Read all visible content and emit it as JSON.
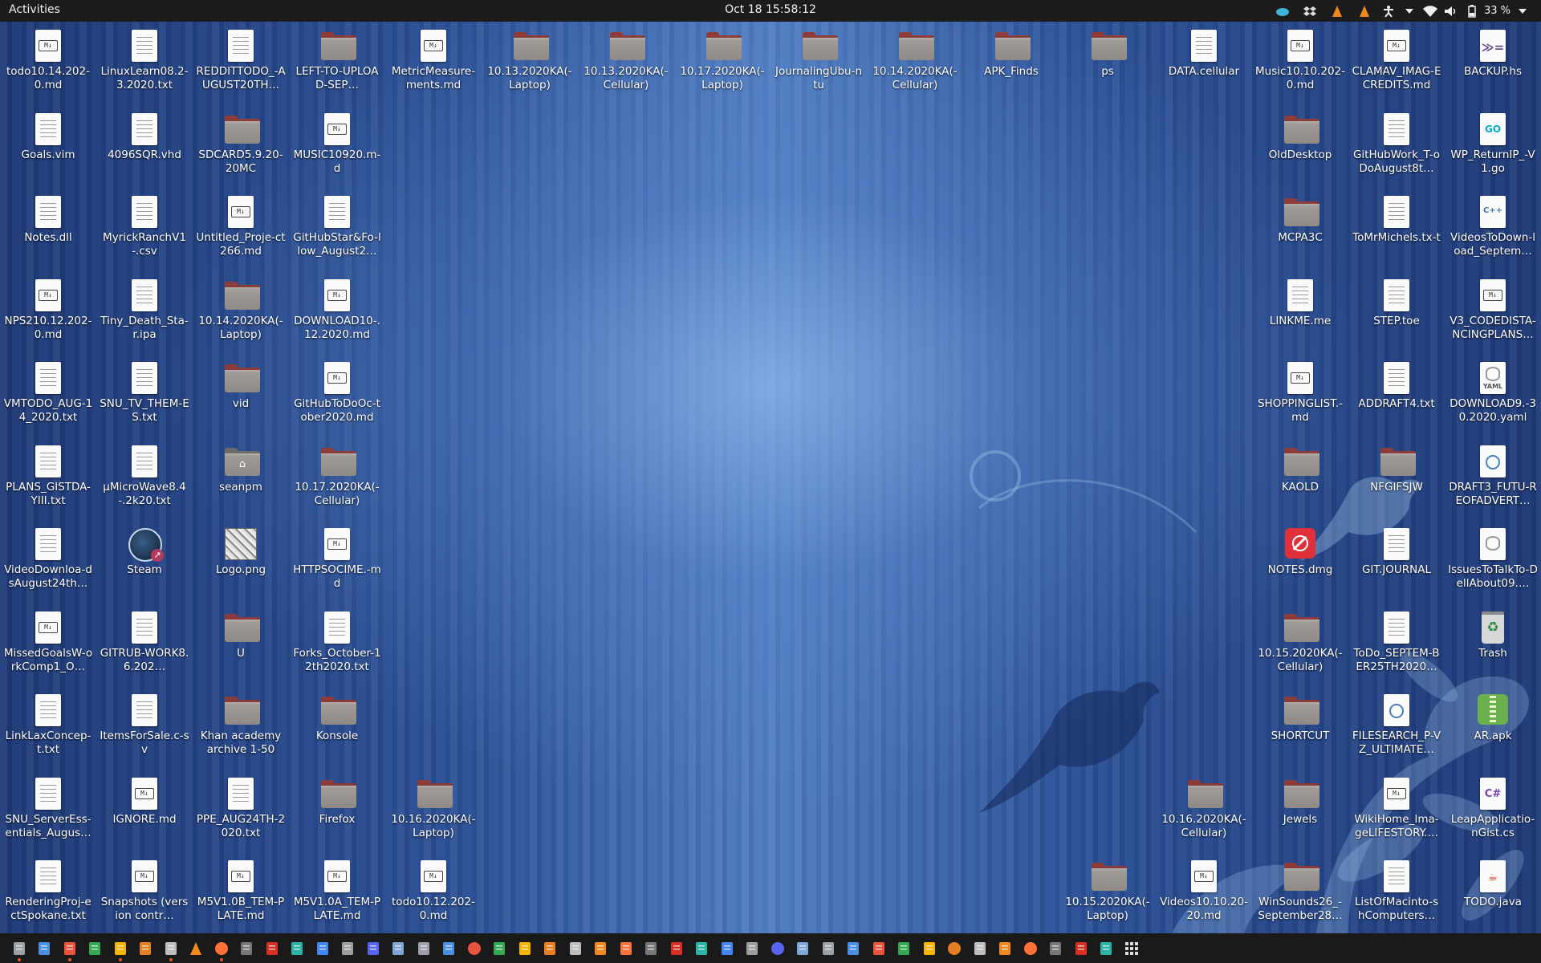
{
  "topbar": {
    "activities": "Activities",
    "clock": "Oct 18  15:58:12",
    "battery": "33 %",
    "tray_icons": [
      "cloud-icon",
      "dropbox-icon",
      "vlc-icon",
      "vlc-icon",
      "accessibility-icon",
      "chevron-down-icon",
      "wifi-icon",
      "volume-icon",
      "battery-icon",
      "chevron-down-icon"
    ]
  },
  "icons": [
    {
      "label": "todo10.14.202-0.md",
      "type": "md",
      "col": 0,
      "row": 0
    },
    {
      "label": "LinuxLearn08.2-3.2020.txt",
      "type": "txt",
      "col": 1,
      "row": 0
    },
    {
      "label": "REDDITTODO_-AUGUST20TH…",
      "type": "txt",
      "col": 2,
      "row": 0
    },
    {
      "label": "LEFT-TO-UPLOAD-SEP…",
      "type": "folder",
      "col": 3,
      "row": 0
    },
    {
      "label": "MetricMeasure-ments.md",
      "type": "md",
      "col": 4,
      "row": 0
    },
    {
      "label": "10.13.2020KA(-Laptop)",
      "type": "folder",
      "col": 5,
      "row": 0
    },
    {
      "label": "10.13.2020KA(-Cellular)",
      "type": "folder",
      "col": 6,
      "row": 0
    },
    {
      "label": "10.17.2020KA(-Laptop)",
      "type": "folder",
      "col": 7,
      "row": 0
    },
    {
      "label": "JournalingUbu-ntu",
      "type": "folder",
      "col": 8,
      "row": 0
    },
    {
      "label": "10.14.2020KA(-Cellular)",
      "type": "folder",
      "col": 9,
      "row": 0
    },
    {
      "label": "APK_Finds",
      "type": "folder",
      "col": 10,
      "row": 0
    },
    {
      "label": "ps",
      "type": "folder",
      "col": 11,
      "row": 0
    },
    {
      "label": "DATA.cellular",
      "type": "txt",
      "col": 12,
      "row": 0
    },
    {
      "label": "Music10.10.202-0.md",
      "type": "md",
      "col": 13,
      "row": 0
    },
    {
      "label": "CLAMAV_IMAG-ECREDITS.md",
      "type": "md",
      "col": 14,
      "row": 0
    },
    {
      "label": "BACKUP.hs",
      "type": "haskell",
      "col": 15,
      "row": 0
    },
    {
      "label": "Goals.vim",
      "type": "txt",
      "col": 0,
      "row": 1
    },
    {
      "label": "4096SQR.vhd",
      "type": "txt",
      "col": 1,
      "row": 1
    },
    {
      "label": "SDCARD5.9.20-20MC",
      "type": "folder",
      "col": 2,
      "row": 1
    },
    {
      "label": "MUSIC10920.m-d",
      "type": "md",
      "col": 3,
      "row": 1
    },
    {
      "label": "OldDesktop",
      "type": "folder",
      "col": 13,
      "row": 1
    },
    {
      "label": "GitHubWork_T-oDoAugust8t…",
      "type": "txt",
      "col": 14,
      "row": 1
    },
    {
      "label": "WP_ReturnIP_-V1.go",
      "type": "go",
      "col": 15,
      "row": 1
    },
    {
      "label": "Notes.dll",
      "type": "txt",
      "col": 0,
      "row": 2
    },
    {
      "label": "MyrickRanchV1-.csv",
      "type": "txt",
      "col": 1,
      "row": 2
    },
    {
      "label": "Untitled_Proje-ct266.md",
      "type": "md",
      "col": 2,
      "row": 2
    },
    {
      "label": "GitHubStar&Fo-llow_August2…",
      "type": "txt",
      "col": 3,
      "row": 2
    },
    {
      "label": "MCPA3C",
      "type": "folder",
      "col": 13,
      "row": 2
    },
    {
      "label": "ToMrMichels.tx-t",
      "type": "txt",
      "col": 14,
      "row": 2
    },
    {
      "label": "VideosToDown-load_Septem…",
      "type": "cpp",
      "col": 15,
      "row": 2
    },
    {
      "label": "NPS210.12.202-0.md",
      "type": "md",
      "col": 0,
      "row": 3
    },
    {
      "label": "Tiny_Death_Sta-r.ipa",
      "type": "txt",
      "col": 1,
      "row": 3
    },
    {
      "label": "10.14.2020KA(-Laptop)",
      "type": "folder",
      "col": 2,
      "row": 3
    },
    {
      "label": "DOWNLOAD10-.12.2020.md",
      "type": "md",
      "col": 3,
      "row": 3
    },
    {
      "label": "LINKME.me",
      "type": "txt",
      "col": 13,
      "row": 3
    },
    {
      "label": "STEP.toe",
      "type": "txt",
      "col": 14,
      "row": 3
    },
    {
      "label": "V3_CODEDISTA-NCINGPLANS…",
      "type": "md",
      "col": 15,
      "row": 3
    },
    {
      "label": "VMTODO_AUG-14_2020.txt",
      "type": "txt",
      "col": 0,
      "row": 4
    },
    {
      "label": "SNU_TV_THEM-ES.txt",
      "type": "txt",
      "col": 1,
      "row": 4
    },
    {
      "label": "vid",
      "type": "folder",
      "col": 2,
      "row": 4
    },
    {
      "label": "GitHubToDoOc-tober2020.md",
      "type": "md",
      "col": 3,
      "row": 4
    },
    {
      "label": "SHOPPINGLIST.-md",
      "type": "md",
      "col": 13,
      "row": 4
    },
    {
      "label": "ADDRAFT4.txt",
      "type": "txt",
      "col": 14,
      "row": 4
    },
    {
      "label": "DOWNLOAD9.-30.2020.yaml",
      "type": "yaml",
      "col": 15,
      "row": 4
    },
    {
      "label": "PLANS_GISTDA-YIII.txt",
      "type": "txt",
      "col": 0,
      "row": 5
    },
    {
      "label": "µMicroWave8.4-.2k20.txt",
      "type": "txt",
      "col": 1,
      "row": 5
    },
    {
      "label": "seanpm",
      "type": "home",
      "col": 2,
      "row": 5
    },
    {
      "label": "10.17.2020KA(-Cellular)",
      "type": "folder",
      "col": 3,
      "row": 5
    },
    {
      "label": "KAOLD",
      "type": "folder",
      "col": 13,
      "row": 5
    },
    {
      "label": "NFGIFSJW",
      "type": "folder",
      "col": 14,
      "row": 5
    },
    {
      "label": "DRAFT3_FUTU-REOFADVERT…",
      "type": "round",
      "col": 15,
      "row": 5
    },
    {
      "label": "VideoDownloa-dsAugust24th…",
      "type": "txt",
      "col": 0,
      "row": 6
    },
    {
      "label": "Steam",
      "type": "steam",
      "col": 1,
      "row": 6
    },
    {
      "label": "Logo.png",
      "type": "image",
      "col": 2,
      "row": 6
    },
    {
      "label": "HTTPSOCIME.-md",
      "type": "md",
      "col": 3,
      "row": 6
    },
    {
      "label": "NOTES.dmg",
      "type": "dmg",
      "col": 13,
      "row": 6
    },
    {
      "label": "GIT.JOURNAL",
      "type": "txt",
      "col": 14,
      "row": 6
    },
    {
      "label": "IssuesToTalkTo-DellAbout09.…",
      "type": "db",
      "col": 15,
      "row": 6
    },
    {
      "label": "MissedGoalsW-orkComp1_O…",
      "type": "md",
      "col": 0,
      "row": 7
    },
    {
      "label": "GITRUB-WORK8.6.202…",
      "type": "txt",
      "col": 1,
      "row": 7
    },
    {
      "label": "U",
      "type": "folder",
      "col": 2,
      "row": 7
    },
    {
      "label": "Forks_October-12th2020.txt",
      "type": "txt",
      "col": 3,
      "row": 7
    },
    {
      "label": "10.15.2020KA(-Cellular)",
      "type": "folder",
      "col": 13,
      "row": 7
    },
    {
      "label": "ToDo_SEPTEM-BER25TH2020…",
      "type": "txt",
      "col": 14,
      "row": 7
    },
    {
      "label": "Trash",
      "type": "trash",
      "col": 15,
      "row": 7
    },
    {
      "label": "LinkLaxConcep-t.txt",
      "type": "txt",
      "col": 0,
      "row": 8
    },
    {
      "label": "ItemsForSale.c-sv",
      "type": "txt",
      "col": 1,
      "row": 8
    },
    {
      "label": "Khan academy archive 1-50",
      "type": "folder",
      "col": 2,
      "row": 8
    },
    {
      "label": "Konsole",
      "type": "folder",
      "col": 3,
      "row": 8
    },
    {
      "label": "SHORTCUT",
      "type": "folder",
      "col": 13,
      "row": 8
    },
    {
      "label": "FILESEARCH_P-VZ_ULTIMATE…",
      "type": "round",
      "col": 14,
      "row": 8
    },
    {
      "label": "AR.apk",
      "type": "apk",
      "col": 15,
      "row": 8
    },
    {
      "label": "SNU_ServerEss-entials_Augus…",
      "type": "txt",
      "col": 0,
      "row": 9
    },
    {
      "label": "IGNORE.md",
      "type": "md",
      "col": 1,
      "row": 9
    },
    {
      "label": "PPE_AUG24TH-2020.txt",
      "type": "txt",
      "col": 2,
      "row": 9
    },
    {
      "label": "Firefox",
      "type": "folder",
      "col": 3,
      "row": 9
    },
    {
      "label": "10.16.2020KA(-Laptop)",
      "type": "folder",
      "col": 4,
      "row": 9
    },
    {
      "label": "10.16.2020KA(-Cellular)",
      "type": "folder",
      "col": 12,
      "row": 9
    },
    {
      "label": "Jewels",
      "type": "folder",
      "col": 13,
      "row": 9
    },
    {
      "label": "WikiHome_Ima-geLIFESTORY.…",
      "type": "md",
      "col": 14,
      "row": 9
    },
    {
      "label": "LeapApplicatio-nGist.cs",
      "type": "csharp",
      "col": 15,
      "row": 9
    },
    {
      "label": "RenderingProj-ectSpokane.txt",
      "type": "txt",
      "col": 0,
      "row": 10
    },
    {
      "label": "Snapshots (version contr…",
      "type": "md",
      "col": 1,
      "row": 10
    },
    {
      "label": "M5V1.0B_TEM-PLATE.md",
      "type": "md",
      "col": 2,
      "row": 10
    },
    {
      "label": "M5V1.0A_TEM-PLATE.md",
      "type": "md",
      "col": 3,
      "row": 10
    },
    {
      "label": "todo10.12.202-0.md",
      "type": "md",
      "col": 4,
      "row": 10
    },
    {
      "label": "10.15.2020KA(-Laptop)",
      "type": "folder",
      "col": 11,
      "row": 10
    },
    {
      "label": "Videos10.10.20-20.md",
      "type": "md",
      "col": 12,
      "row": 10
    },
    {
      "label": "WinSounds26_-September28…",
      "type": "folder",
      "col": 13,
      "row": 10
    },
    {
      "label": "ListOfMacinto-shComputers…",
      "type": "txt",
      "col": 14,
      "row": 10
    },
    {
      "label": "TODO.java",
      "type": "java",
      "col": 15,
      "row": 10
    }
  ],
  "colors": {
    "folder_tab": "#8d3b3b",
    "topbar": "#1c1c1c",
    "taskbar": "#1a1a1a",
    "desktop": "#2f4e8f"
  },
  "taskbar": [
    "terminal-icon",
    "text-editor-icon",
    "calendar-icon",
    "spreadsheet-icon",
    "notes-icon",
    "writer-icon",
    "files-icon",
    "vlc-icon",
    "firefox-icon",
    "terminal-icon",
    "bookmark-icon",
    "app-icon",
    "doc-icon",
    "calc-icon",
    "discord-icon",
    "search-icon",
    "phone-icon",
    "archive-icon",
    "circle-icon",
    "ubuntu-store-icon",
    "screenshot-icon",
    "package-icon",
    "shield-icon",
    "gauge-icon",
    "doc-icon",
    "image-icon",
    "tool-icon",
    "monitor-icon",
    "editor-icon",
    "settings-icon",
    "circle-icon",
    "app-icon",
    "calendar-icon",
    "discord-icon",
    "folder-icon",
    "gauge-icon",
    "arrow-icon",
    "steam-icon",
    "cloud-icon",
    "game-icon",
    "blender-icon",
    "bluetooth-icon",
    "terminal-icon",
    "cloud-icon",
    "apps-grid-icon"
  ]
}
